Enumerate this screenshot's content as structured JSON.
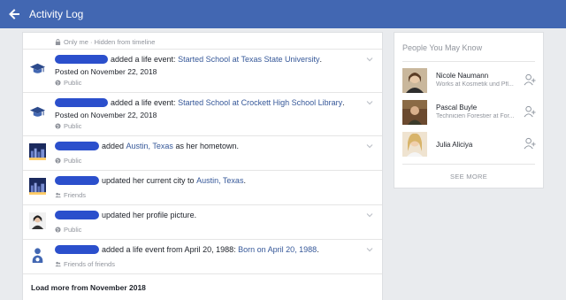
{
  "header": {
    "title": "Activity Log"
  },
  "log": {
    "hidden_notice": "Only me · Hidden from timeline",
    "entries": [
      {
        "action": "added a life event:",
        "link": "Started School at Texas State University",
        "tail": ".",
        "posted": "Posted on November 22, 2018",
        "audience": "Public",
        "icon": "mortarboard-icon"
      },
      {
        "action": "added a life event:",
        "link": "Started School at Crockett High School Library",
        "tail": ".",
        "posted": "Posted on November 22, 2018",
        "audience": "Public",
        "icon": "mortarboard-icon"
      },
      {
        "action": "added",
        "link": "Austin, Texas",
        "tail": "as her hometown.",
        "audience": "Public",
        "icon": "city-photo"
      },
      {
        "action": "updated her current city to",
        "link": "Austin, Texas",
        "tail": ".",
        "audience": "Friends",
        "icon": "city-photo"
      },
      {
        "action": "updated her profile picture.",
        "link": "",
        "tail": "",
        "audience": "Public",
        "icon": "profile-photo"
      },
      {
        "action": "added a life event from April 20, 1988:",
        "link": "Born on April 20, 1988",
        "tail": ".",
        "audience": "Friends of friends",
        "icon": "baby-icon"
      }
    ],
    "load_more": "Load more from November 2018"
  },
  "pymk": {
    "title": "People You May Know",
    "people": [
      {
        "name": "Nicole Naumann",
        "job": "Works at Kosmetik und Pfl..."
      },
      {
        "name": "Pascal Buyle",
        "job": "Technicien Forestier at For..."
      },
      {
        "name": "Julia Aliciya",
        "job": ""
      }
    ],
    "see_more": "SEE MORE"
  },
  "colors": {
    "header": "#4267b2",
    "link": "#365899",
    "redaction": "#2b4fcc"
  }
}
